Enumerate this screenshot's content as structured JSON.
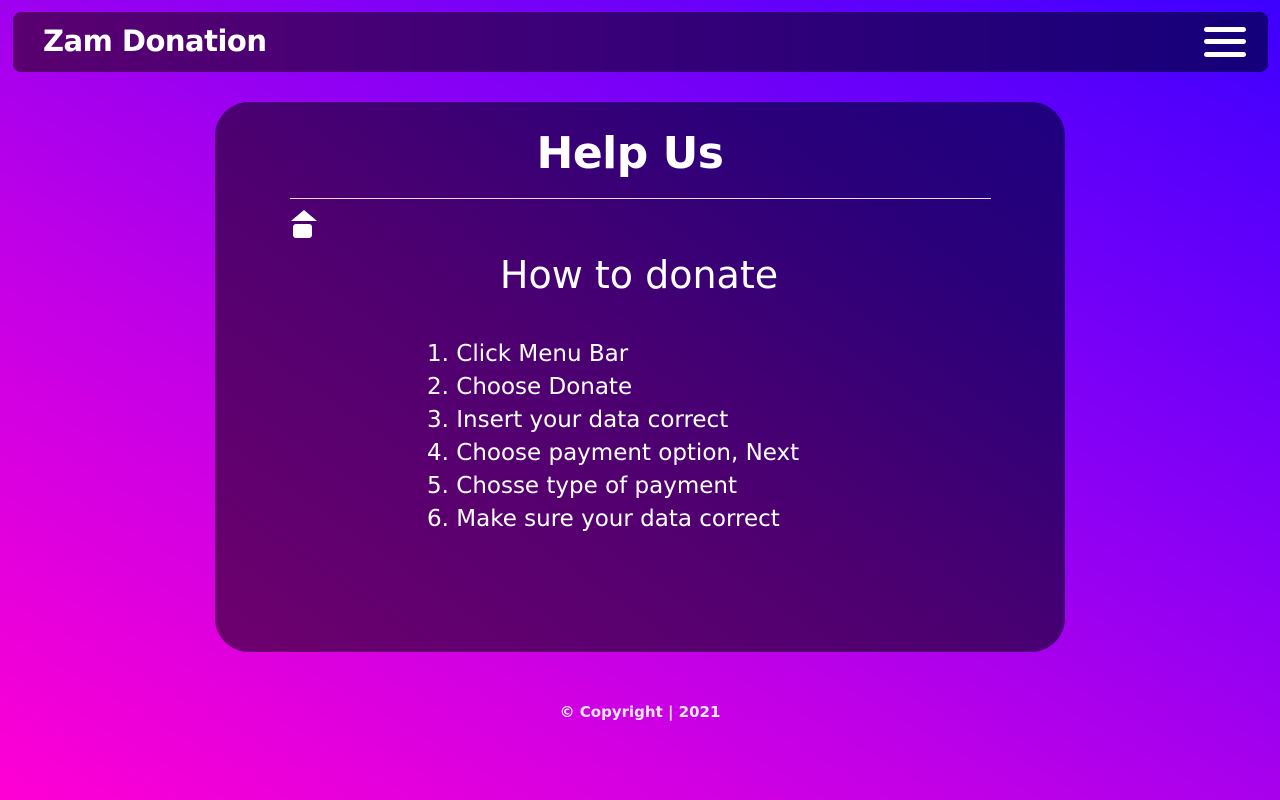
{
  "navbar": {
    "brand": "Zam Donation",
    "menu_icon": "hamburger-menu-icon"
  },
  "card": {
    "title": "Help Us",
    "home_icon": "home-icon",
    "section_title": "How to donate",
    "steps": [
      "1. Click Menu Bar",
      "2. Choose Donate",
      "3. Insert your data correct",
      "4. Choose payment option, Next",
      "5. Chosse type of payment",
      "6. Make sure your data correct"
    ]
  },
  "footer": {
    "copyright": "© Copyright | 2021"
  },
  "colors": {
    "background_start": "#ff00d4",
    "background_end": "#3d00ff",
    "navbar": "#3a0078",
    "card": "#4e0070",
    "text": "#ffffff"
  }
}
